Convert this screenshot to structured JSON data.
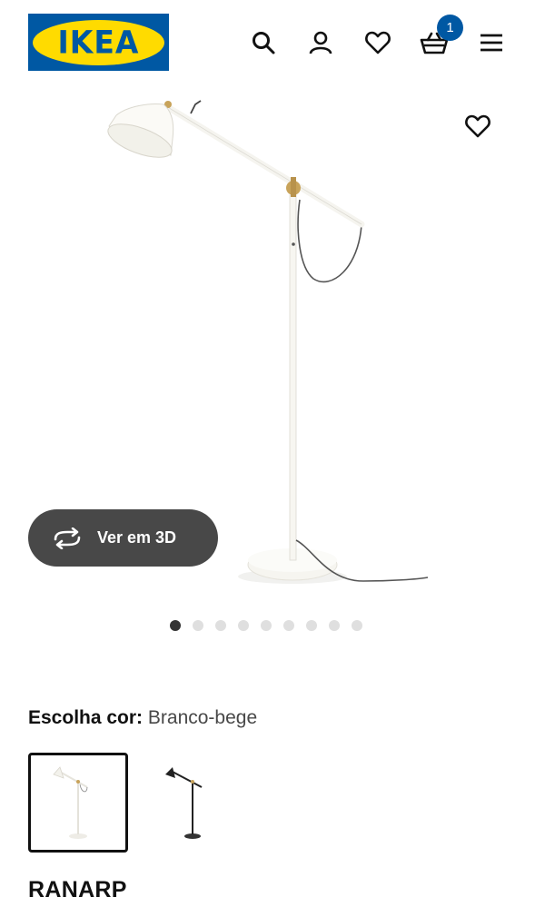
{
  "header": {
    "logo_text": "IKEA",
    "cart_count": "1",
    "icons": [
      "search-icon",
      "account-icon",
      "favorites-icon",
      "cart-icon",
      "menu-icon"
    ]
  },
  "product_image": {
    "view3d_label": "Ver em 3D",
    "slide_count": 9,
    "active_slide": 1
  },
  "color_choice": {
    "label": "Escolha cor:",
    "selected": "Branco-bege"
  },
  "product": {
    "name": "RANARP"
  },
  "colors": {
    "ikea_blue": "#0058a3",
    "ikea_yellow": "#ffdb00",
    "button_dark": "#484848"
  }
}
